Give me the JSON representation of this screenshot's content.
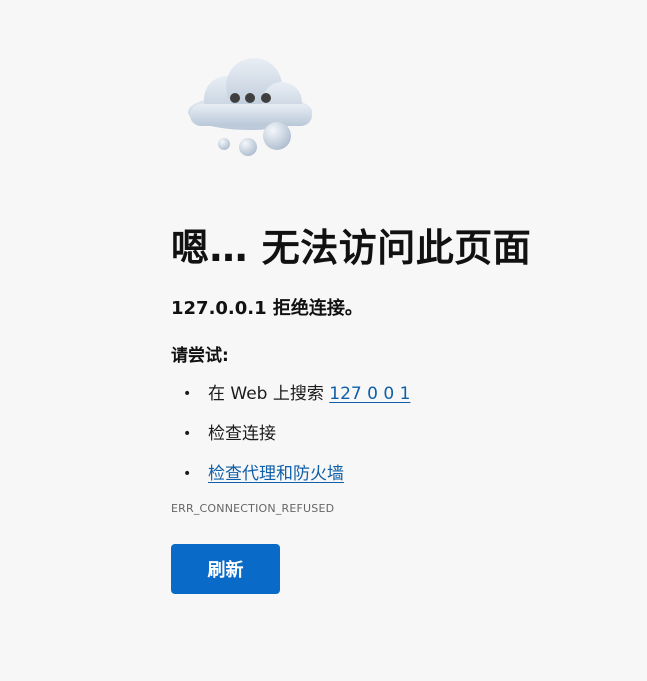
{
  "error_page": {
    "title": "嗯… 无法访问此页面",
    "subtitle": "127.0.0.1 拒绝连接。",
    "try_heading": "请尝试:",
    "suggestions": [
      {
        "prefix": "在 Web 上搜索 ",
        "link": "127 0 0 1"
      },
      {
        "text": "检查连接"
      },
      {
        "link": "检查代理和防火墙"
      }
    ],
    "bullet": "•",
    "error_code": "ERR_CONNECTION_REFUSED",
    "refresh_label": "刷新",
    "illustration_icon": "cloud-error-icon"
  },
  "colors": {
    "background": "#f7f7f7",
    "link": "#0f5fa8",
    "button": "#0a6ac7"
  }
}
